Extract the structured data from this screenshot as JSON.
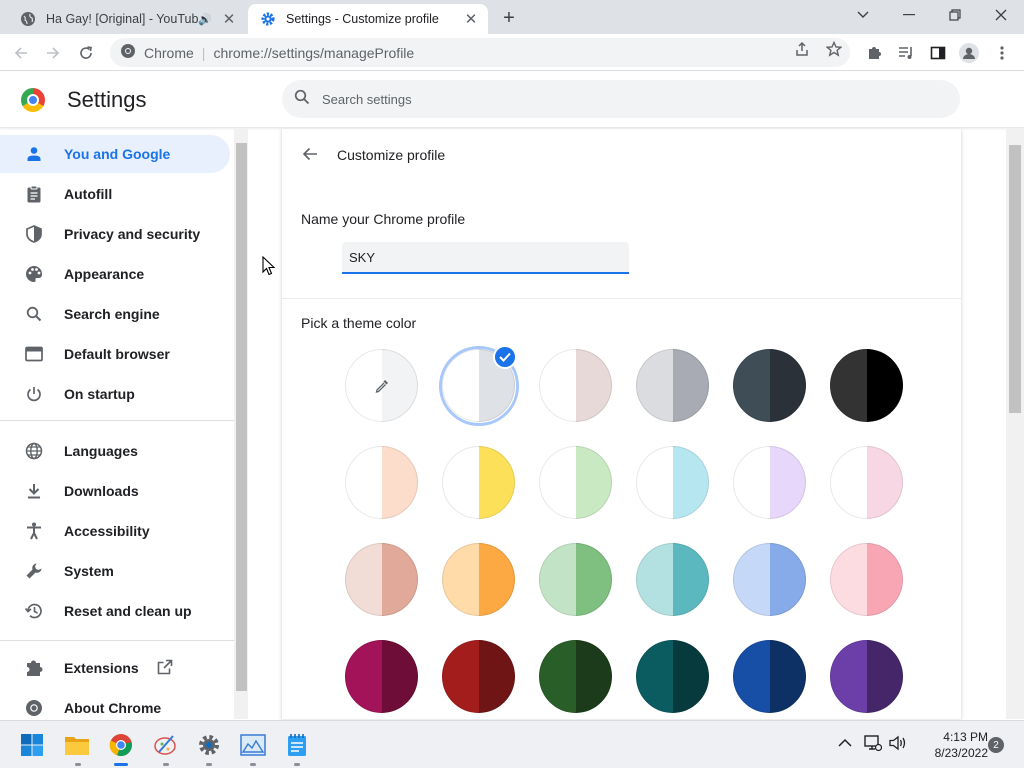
{
  "tabs": [
    {
      "title": "Ha Gay! [Original] - YouTube",
      "favicon": "globe-icon",
      "muted_icon": "speaker-icon"
    },
    {
      "title": "Settings - Customize profile",
      "favicon": "gear-icon"
    }
  ],
  "omnibox": {
    "site": "Chrome",
    "url": "chrome://settings/manageProfile"
  },
  "settings": {
    "title": "Settings",
    "search_placeholder": "Search settings"
  },
  "sidebar": {
    "items": [
      {
        "label": "You and Google",
        "icon": "person-icon"
      },
      {
        "label": "Autofill",
        "icon": "clipboard-icon"
      },
      {
        "label": "Privacy and security",
        "icon": "shield-icon"
      },
      {
        "label": "Appearance",
        "icon": "palette-icon"
      },
      {
        "label": "Search engine",
        "icon": "search-icon"
      },
      {
        "label": "Default browser",
        "icon": "browser-icon"
      },
      {
        "label": "On startup",
        "icon": "power-icon"
      },
      {
        "label": "Languages",
        "icon": "globe-icon"
      },
      {
        "label": "Downloads",
        "icon": "download-icon"
      },
      {
        "label": "Accessibility",
        "icon": "accessibility-icon"
      },
      {
        "label": "System",
        "icon": "wrench-icon"
      },
      {
        "label": "Reset and clean up",
        "icon": "restore-icon"
      },
      {
        "label": "Extensions",
        "icon": "puzzle-icon"
      },
      {
        "label": "About Chrome",
        "icon": "chrome-icon"
      }
    ],
    "active_index": 0
  },
  "profile": {
    "page_title": "Customize profile",
    "name_label": "Name your Chrome profile",
    "name_value": "SKY",
    "theme_label": "Pick a theme color"
  },
  "theme_colors": [
    {
      "left": "#ffffff",
      "right": "#f1f3f4"
    },
    {
      "left": "#ffffff",
      "right": "#dee1e6",
      "selected": true
    },
    {
      "left": "#ffffff",
      "right": "#e6d9d7"
    },
    {
      "left": "#dadce0",
      "right": "#a8abb4"
    },
    {
      "left": "#3f4d57",
      "right": "#2a3138"
    },
    {
      "left": "#333333",
      "right": "#000000"
    },
    {
      "left": "#ffffff",
      "right": "#fcdccb"
    },
    {
      "left": "#ffffff",
      "right": "#fde05a"
    },
    {
      "left": "#ffffff",
      "right": "#c9e9c2"
    },
    {
      "left": "#ffffff",
      "right": "#b6e6f0"
    },
    {
      "left": "#ffffff",
      "right": "#e7d7fb"
    },
    {
      "left": "#ffffff",
      "right": "#f7d7e4"
    },
    {
      "left": "#f2dcd6",
      "right": "#e0a99a"
    },
    {
      "left": "#fedba9",
      "right": "#fca843"
    },
    {
      "left": "#c3e3c6",
      "right": "#7fbf7f"
    },
    {
      "left": "#b3e0e1",
      "right": "#5bb8bf"
    },
    {
      "left": "#c6d8f7",
      "right": "#87aae8"
    },
    {
      "left": "#fcdbe1",
      "right": "#f8a6b4"
    },
    {
      "left": "#a3135a",
      "right": "#6e0d38"
    },
    {
      "left": "#a31d1d",
      "right": "#6f1515"
    },
    {
      "left": "#2a5e28",
      "right": "#1b3b1a"
    },
    {
      "left": "#0a5c61",
      "right": "#073a3d"
    },
    {
      "left": "#174ea6",
      "right": "#0d3165"
    },
    {
      "left": "#6b3ea8",
      "right": "#452769"
    }
  ],
  "taskbar": {
    "apps": [
      "windows-start-icon",
      "file-explorer-icon",
      "chrome-icon",
      "paint-icon",
      "settings-icon",
      "photos-icon",
      "notepad-icon"
    ],
    "time": "4:13 PM",
    "date": "8/23/2022",
    "notifications": "2"
  }
}
